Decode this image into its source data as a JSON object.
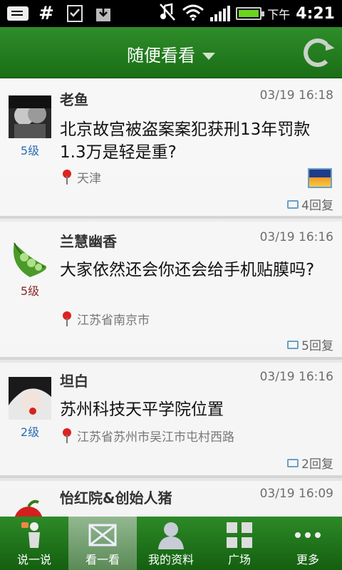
{
  "status_bar": {
    "icons": [
      "message-icon",
      "hash-icon",
      "task-icon",
      "download-icon",
      "mute-icon",
      "wifi-icon",
      "signal-icon",
      "battery-icon"
    ],
    "hash_glyph": "#",
    "ampm": "下午",
    "time": "4:21"
  },
  "header": {
    "title": "随便看看"
  },
  "posts": [
    {
      "user": "老鱼",
      "level": "5级",
      "level_color": "#2a6db5",
      "time": "03/19 16:18",
      "text": "北京故宫被盗案案犯获刑13年罚款1.3万是轻是重?",
      "location": "天津",
      "replies": "4回复",
      "has_photo": true
    },
    {
      "user": "兰慧幽香",
      "level": "5级",
      "level_color": "#8a2a2a",
      "time": "03/19 16:16",
      "text": "大家依然还会你还会给手机贴膜吗?",
      "location": "江苏省南京市",
      "replies": "5回复",
      "has_photo": false
    },
    {
      "user": "坦白",
      "level": "2级",
      "level_color": "#2a6db5",
      "time": "03/19 16:16",
      "text": "苏州科技天平学院位置",
      "location": "江苏省苏州市吴江市屯村西路",
      "replies": "2回复",
      "has_photo": false
    },
    {
      "user": "怡红院&创始人猪",
      "time": "03/19 16:09"
    }
  ],
  "nav": [
    {
      "label": "说一说",
      "icon": "speak-icon"
    },
    {
      "label": "看一看",
      "icon": "mail-icon",
      "active": true
    },
    {
      "label": "我的资料",
      "icon": "profile-icon"
    },
    {
      "label": "广场",
      "icon": "grid-icon"
    },
    {
      "label": "更多",
      "icon": "more-icon"
    }
  ]
}
